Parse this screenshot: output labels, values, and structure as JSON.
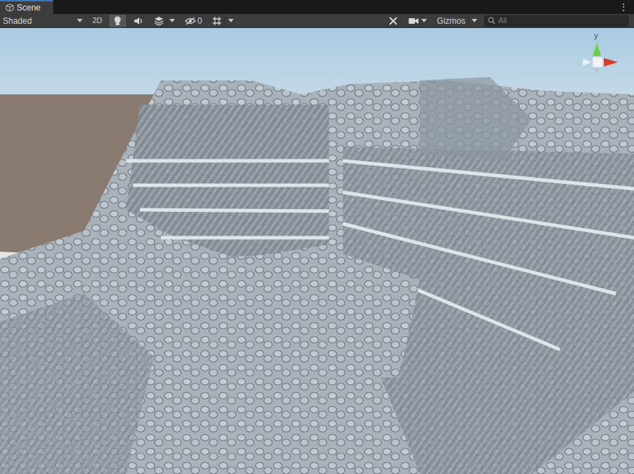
{
  "window": {
    "tab": {
      "label": "Scene",
      "selected": true
    },
    "menu_icon": "⋮"
  },
  "toolbar": {
    "draw_mode": "Shaded",
    "toggle_2d": {
      "label": "2D",
      "on": false
    },
    "lighting": {
      "on": true
    },
    "audio": {
      "on": false
    },
    "effects": {
      "on": false
    },
    "hidden_count": "0",
    "gizmos": "Gizmos",
    "search": {
      "placeholder": "All"
    }
  },
  "gizmo": {
    "axis_label": "y"
  }
}
